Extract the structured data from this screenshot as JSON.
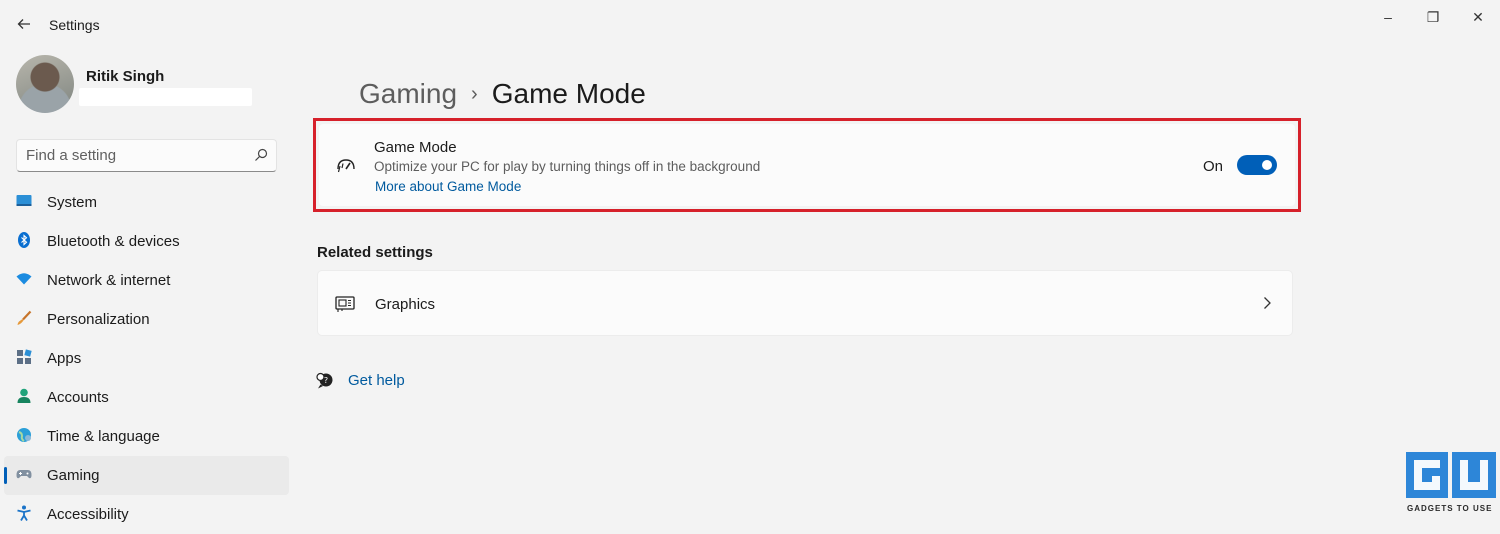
{
  "window": {
    "title": "Settings",
    "back_icon": "back-arrow-icon",
    "controls": {
      "minimize": "–",
      "maximize": "❐",
      "close": "✕"
    }
  },
  "profile": {
    "name": "Ritik Singh"
  },
  "search": {
    "placeholder": "Find a setting",
    "icon": "search-icon"
  },
  "sidebar": {
    "items": [
      {
        "label": "System",
        "icon": "system-icon",
        "active": false
      },
      {
        "label": "Bluetooth & devices",
        "icon": "bluetooth-icon",
        "active": false
      },
      {
        "label": "Network & internet",
        "icon": "wifi-icon",
        "active": false
      },
      {
        "label": "Personalization",
        "icon": "brush-icon",
        "active": false
      },
      {
        "label": "Apps",
        "icon": "apps-icon",
        "active": false
      },
      {
        "label": "Accounts",
        "icon": "person-icon",
        "active": false
      },
      {
        "label": "Time & language",
        "icon": "globe-icon",
        "active": false
      },
      {
        "label": "Gaming",
        "icon": "gamepad-icon",
        "active": true
      },
      {
        "label": "Accessibility",
        "icon": "accessibility-icon",
        "active": false
      }
    ]
  },
  "breadcrumb": {
    "parent": "Gaming",
    "separator": "›",
    "current": "Game Mode"
  },
  "game_mode": {
    "title": "Game Mode",
    "description": "Optimize your PC for play by turning things off in the background",
    "link": "More about Game Mode",
    "state_label": "On",
    "enabled": true,
    "icon": "speedometer-icon"
  },
  "related": {
    "heading": "Related settings",
    "items": [
      {
        "label": "Graphics",
        "icon": "graphics-card-icon"
      }
    ]
  },
  "help": {
    "label": "Get help",
    "icon": "help-chat-icon"
  },
  "watermark": {
    "text": "GADGETS TO USE"
  },
  "colors": {
    "accent": "#005fb8",
    "link": "#005a9e",
    "highlight_frame": "#d6202a",
    "background": "#f3f3f3",
    "card": "#fbfbfb"
  }
}
